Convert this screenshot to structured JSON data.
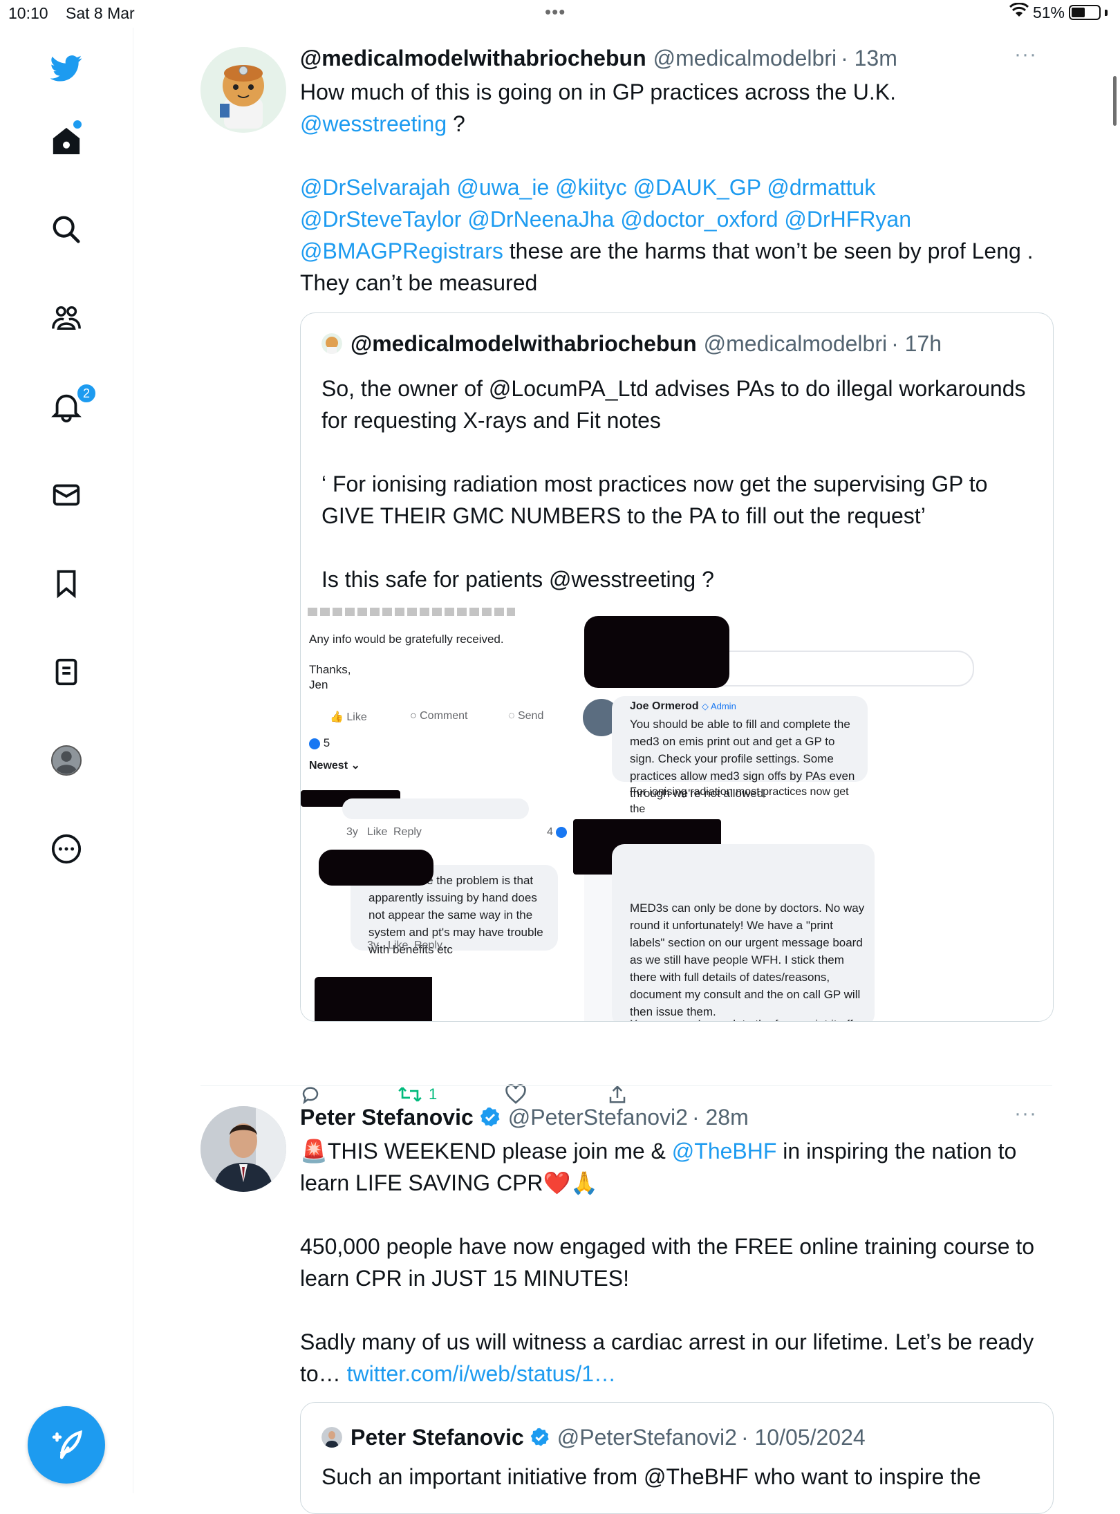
{
  "status_bar": {
    "time": "10:10",
    "date": "Sat 8 Mar",
    "wifi_icon": "wifi-icon",
    "battery": "51%",
    "battery_fraction": 0.51
  },
  "sidebar": {
    "items": [
      "twitter-logo",
      "home-icon",
      "search-icon",
      "communities-icon",
      "notifications-icon",
      "messages-icon",
      "bookmarks-icon",
      "lists-icon",
      "profile-icon",
      "more-icon"
    ],
    "notifications_badge": "2",
    "compose": "compose-icon",
    "accent": "#1d9bf0"
  },
  "tweet1": {
    "name": "@medicalmodelwithabriochebun",
    "handle": "@medicalmodelbri",
    "time": "· 13m",
    "more": "···",
    "line1": "How much of this is going on in GP practices across the U.K.",
    "mention_first": "@wesstreeting",
    "q_mark": " ?",
    "mentions_line1": "@DrSelvarajah @uwa_ie @kiityc @DAUK_GP @drmattuk",
    "mentions_line2": "@DrSteveTaylor @DrNeenaJha @doctor_oxford @DrHFRyan",
    "mention_last": "@BMAGPRegistrars",
    "rest": " these are the harms that won’t be seen by prof Leng . They can’t be measured",
    "quote": {
      "name": "@medicalmodelwithabriochebun",
      "handle": "@medicalmodelbri",
      "time": "· 17h",
      "p1": "So, the owner of @LocumPA_Ltd advises PAs to do illegal workarounds for requesting X-rays and Fit notes",
      "p2": "‘ For ionising radiation most practices now get the supervising GP to GIVE THEIR GMC NUMBERS to the PA to fill out the request’",
      "p3": "Is this safe for patients @wesstreeting ?",
      "screenshot": {
        "any_info": "Any info would be gratefully received.",
        "thanks": "Thanks,",
        "jen": "Jen",
        "like": "Like",
        "comment": "Comment",
        "send": "Send",
        "reactions": "5",
        "newest": "Newest",
        "meta1_time": "3y",
        "meta1_like": "Like",
        "meta1_reply": "Reply",
        "count4": "4",
        "bubble_left": "do the same the problem is that apparently issuing by hand does not appear the same way in the system and pt's may have trouble with benefits etc",
        "meta2_time": "3y",
        "meta2_like": "Like",
        "meta2_reply": "Reply",
        "commenter": "Joe Ormerod",
        "admin": "Admin",
        "joe_text": "You should be able to fill and complete the med3 on emis print out and get a GP to sign. Check your profile settings. Some practices allow med3 sign offs by PAs even through we're not allowed.",
        "joe_cut": "For ionising radiation most practices now get the",
        "right_p1": "MED3s can only be done by doctors. No way round it unfortunately! We have a \"print labels\" section on our urgent message board as we still have people WFH. I stick them there with full details of dates/reasons, document my consult and the on call GP will then issue them.",
        "right_p2": "X-rays, now, I complete the form, print it off,"
      }
    },
    "actions": {
      "reply": "reply-icon",
      "retweet_count": "1",
      "like": "like-icon",
      "share": "share-icon",
      "retweet_color": "#00ba7c"
    }
  },
  "tweet2": {
    "name": "Peter Stefanovic",
    "handle": "@PeterStefanovi2",
    "time": "· 28m",
    "more": "···",
    "siren": "🚨",
    "l1a": "THIS WEEKEND please join me & ",
    "l1_mention": "@TheBHF",
    "l1b": " in inspiring the nation to learn LIFE SAVING CPR",
    "emojis": "❤️🙏",
    "p2": "450,000 people have now engaged with the FREE online training course to learn CPR in JUST 15 MINUTES!",
    "p3": "Sadly many of us will witness a cardiac arrest in our lifetime. Let’s be ready to… ",
    "link": "twitter.com/i/web/status/1…",
    "quote": {
      "name": "Peter Stefanovic",
      "handle": "@PeterStefanovi2",
      "time": "· 10/05/2024",
      "text": "Such an important initiative from @TheBHF who want to inspire the"
    }
  }
}
